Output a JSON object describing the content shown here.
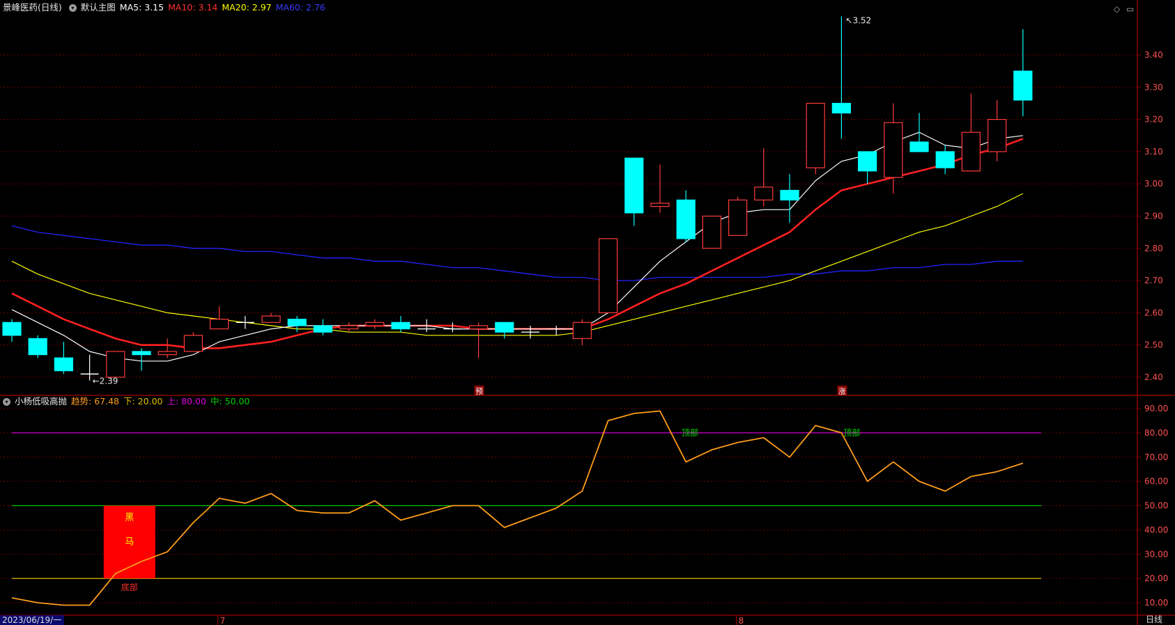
{
  "colors": {
    "bg": "#000000",
    "grid": "#6b0000",
    "axis": "#8b0000",
    "bull": "#ff3b3b",
    "bear": "#00ffff",
    "ma5": "#ffffff",
    "ma10": "#ff2020",
    "ma20": "#ffff00",
    "ma60": "#2323ff",
    "osc": "#ff9d1a",
    "upper": "#cc00cc",
    "lower": "#e0c000",
    "mid": "#00cc00",
    "signal": "#ff0000"
  },
  "main_header": {
    "stock": "景峰医药(日线)",
    "view_icon": "chevron-down-icon",
    "view": "默认主图",
    "ma5": "MA5: 3.15",
    "ma10": "MA10: 3.14",
    "ma20": "MA20: 2.97",
    "ma60": "MA60: 2.76"
  },
  "sub_header": {
    "view_icon": "chevron-down-icon",
    "name": "小杨低吸高抛",
    "trend": "趋势: 67.48",
    "lower": "下: 20.00",
    "upper": "上: 80.00",
    "mid": "中: 50.00"
  },
  "bottom": {
    "date": "2023/06/19/一",
    "period": "日线",
    "month_labels": [
      "7",
      "8"
    ]
  },
  "chart_data": [
    {
      "type": "candlestick",
      "y_ticks": [
        "3.40",
        "3.30",
        "3.20",
        "3.10",
        "3.00",
        "2.90",
        "2.80",
        "2.70",
        "2.60",
        "2.50",
        "2.40"
      ],
      "ylim": [
        2.36,
        3.54
      ],
      "ohlc": [
        [
          2.57,
          2.58,
          2.51,
          2.53
        ],
        [
          2.52,
          2.53,
          2.46,
          2.47
        ],
        [
          2.46,
          2.51,
          2.41,
          2.42
        ],
        [
          2.41,
          2.47,
          2.39,
          2.41
        ],
        [
          2.4,
          2.48,
          2.4,
          2.48
        ],
        [
          2.48,
          2.49,
          2.42,
          2.47
        ],
        [
          2.47,
          2.52,
          2.46,
          2.48
        ],
        [
          2.48,
          2.54,
          2.48,
          2.53
        ],
        [
          2.55,
          2.62,
          2.55,
          2.58
        ],
        [
          2.57,
          2.59,
          2.55,
          2.57
        ],
        [
          2.57,
          2.6,
          2.57,
          2.59
        ],
        [
          2.58,
          2.59,
          2.54,
          2.56
        ],
        [
          2.56,
          2.58,
          2.53,
          2.54
        ],
        [
          2.55,
          2.57,
          2.54,
          2.56
        ],
        [
          2.56,
          2.58,
          2.55,
          2.57
        ],
        [
          2.57,
          2.59,
          2.54,
          2.55
        ],
        [
          2.55,
          2.58,
          2.54,
          2.55
        ],
        [
          2.55,
          2.57,
          2.54,
          2.55
        ],
        [
          2.55,
          2.57,
          2.46,
          2.56
        ],
        [
          2.57,
          2.57,
          2.52,
          2.54
        ],
        [
          2.54,
          2.56,
          2.52,
          2.54
        ],
        [
          2.55,
          2.56,
          2.53,
          2.55
        ],
        [
          2.52,
          2.58,
          2.5,
          2.57
        ],
        [
          2.6,
          2.83,
          2.6,
          2.83
        ],
        [
          3.08,
          3.08,
          2.87,
          2.91
        ],
        [
          2.93,
          3.06,
          2.91,
          2.94
        ],
        [
          2.95,
          2.98,
          2.82,
          2.83
        ],
        [
          2.8,
          2.9,
          2.8,
          2.9
        ],
        [
          2.84,
          2.96,
          2.84,
          2.95
        ],
        [
          2.95,
          3.11,
          2.93,
          2.99
        ],
        [
          2.98,
          3.03,
          2.88,
          2.95
        ],
        [
          3.05,
          3.25,
          3.03,
          3.25
        ],
        [
          3.25,
          3.52,
          3.14,
          3.22
        ],
        [
          3.1,
          3.1,
          3.0,
          3.04
        ],
        [
          3.02,
          3.25,
          2.97,
          3.19
        ],
        [
          3.13,
          3.22,
          3.1,
          3.1
        ],
        [
          3.1,
          3.12,
          3.03,
          3.05
        ],
        [
          3.04,
          3.28,
          3.04,
          3.16
        ],
        [
          3.1,
          3.26,
          3.07,
          3.2
        ],
        [
          3.35,
          3.48,
          3.21,
          3.26
        ]
      ],
      "ma5": [
        2.61,
        2.57,
        2.53,
        2.48,
        2.46,
        2.45,
        2.45,
        2.47,
        2.51,
        2.53,
        2.55,
        2.56,
        2.56,
        2.56,
        2.56,
        2.56,
        2.56,
        2.55,
        2.55,
        2.55,
        2.55,
        2.55,
        2.55,
        2.6,
        2.68,
        2.76,
        2.82,
        2.88,
        2.91,
        2.92,
        2.92,
        3.01,
        3.07,
        3.09,
        3.13,
        3.16,
        3.12,
        3.11,
        3.14,
        3.15
      ],
      "ma10": [
        2.66,
        2.62,
        2.58,
        2.55,
        2.52,
        2.5,
        2.5,
        2.49,
        2.49,
        2.5,
        2.51,
        2.53,
        2.55,
        2.56,
        2.56,
        2.56,
        2.56,
        2.56,
        2.55,
        2.55,
        2.55,
        2.55,
        2.55,
        2.58,
        2.62,
        2.66,
        2.69,
        2.73,
        2.77,
        2.81,
        2.85,
        2.92,
        2.98,
        3.0,
        3.02,
        3.04,
        3.06,
        3.09,
        3.11,
        3.14
      ],
      "ma20": [
        2.76,
        2.72,
        2.69,
        2.66,
        2.64,
        2.62,
        2.6,
        2.59,
        2.58,
        2.57,
        2.56,
        2.55,
        2.55,
        2.54,
        2.54,
        2.54,
        2.53,
        2.53,
        2.53,
        2.53,
        2.53,
        2.53,
        2.54,
        2.56,
        2.58,
        2.6,
        2.62,
        2.64,
        2.66,
        2.68,
        2.7,
        2.73,
        2.76,
        2.79,
        2.82,
        2.85,
        2.87,
        2.9,
        2.93,
        2.97
      ],
      "ma60": [
        2.87,
        2.85,
        2.84,
        2.83,
        2.82,
        2.81,
        2.81,
        2.8,
        2.8,
        2.79,
        2.79,
        2.78,
        2.77,
        2.77,
        2.76,
        2.76,
        2.75,
        2.74,
        2.74,
        2.73,
        2.72,
        2.71,
        2.71,
        2.7,
        2.7,
        2.71,
        2.71,
        2.71,
        2.71,
        2.71,
        2.72,
        2.72,
        2.73,
        2.73,
        2.74,
        2.74,
        2.75,
        2.75,
        2.76,
        2.76
      ],
      "annotations": {
        "low_label": "2.39",
        "high_label": "3.52",
        "marker1": "预",
        "marker2": "涨"
      }
    },
    {
      "type": "line",
      "y_ticks": [
        "90.00",
        "80.00",
        "70.00",
        "60.00",
        "50.00",
        "40.00",
        "30.00",
        "20.00",
        "10.00"
      ],
      "ylim": [
        5,
        95
      ],
      "trend": [
        12,
        10,
        9,
        9,
        22,
        27,
        31,
        43,
        53,
        51,
        55,
        48,
        47,
        47,
        52,
        44,
        47,
        50,
        50,
        41,
        45,
        49,
        56,
        85,
        88,
        89,
        68,
        73,
        76,
        78,
        70,
        83,
        80,
        60,
        68,
        60,
        56,
        62,
        64,
        67.48
      ],
      "levels": {
        "upper": 80,
        "mid": 50,
        "lower": 20
      },
      "signals": {
        "black_horse_1": "黑",
        "black_horse_2": "马",
        "bottom": "底部",
        "top": "顶部"
      }
    }
  ]
}
